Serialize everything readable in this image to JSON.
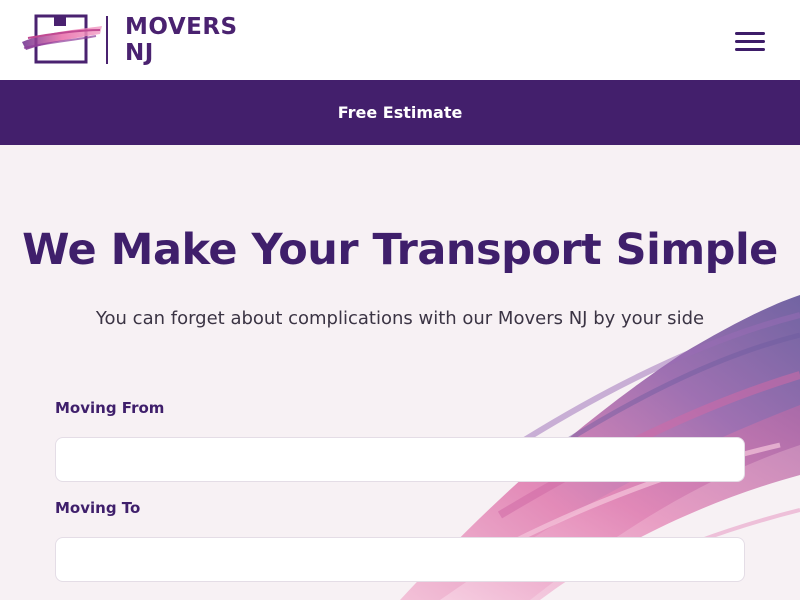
{
  "header": {
    "logo_line1": "MOVERS",
    "logo_line2": "NJ",
    "menu_icon": "hamburger-menu-icon"
  },
  "banner": {
    "label": "Free Estimate"
  },
  "hero": {
    "title": "We Make Your Transport Simple",
    "subtitle": "You can forget about complications with our Movers NJ by your side"
  },
  "form": {
    "moving_from_label": "Moving From",
    "moving_from_value": "",
    "moving_to_label": "Moving To",
    "moving_to_value": ""
  },
  "colors": {
    "brand_purple": "#431f6c",
    "hero_background": "#f7f1f4",
    "brush_pink": "#e07fb0",
    "brush_violet": "#7a4a9c"
  }
}
